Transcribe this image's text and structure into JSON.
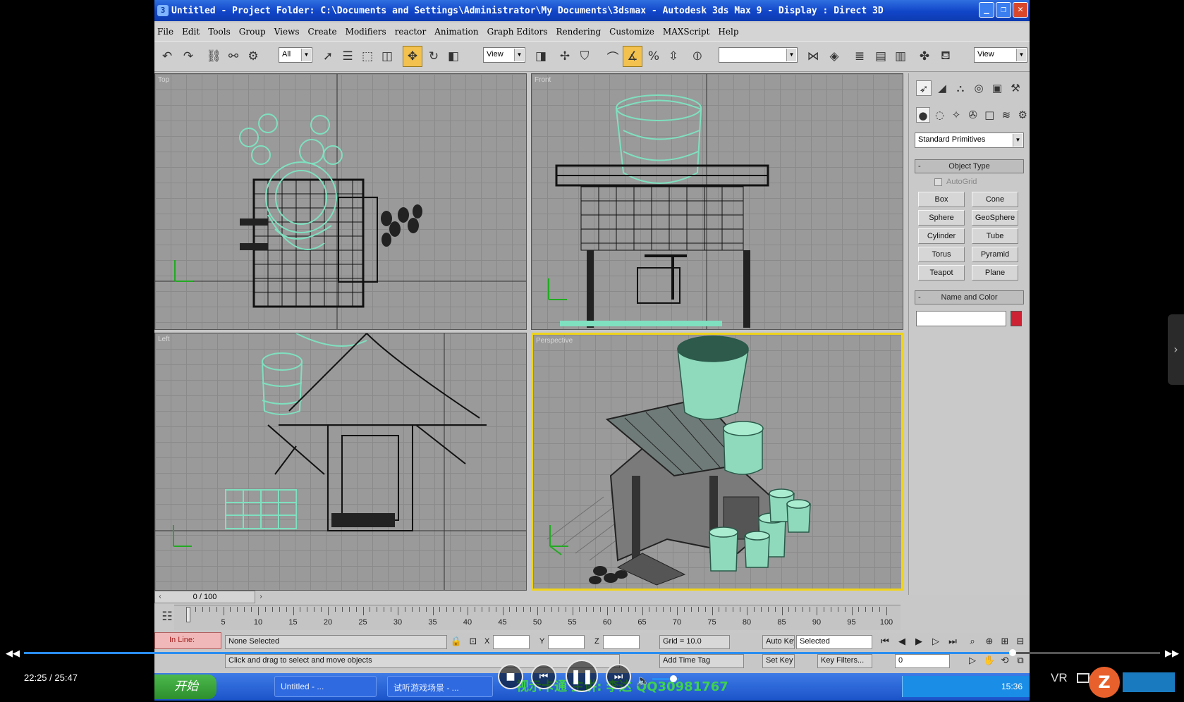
{
  "window": {
    "title": "Untitled     - Project Folder: C:\\Documents and Settings\\Administrator\\My Documents\\3dsmax     - Autodesk 3ds Max 9     - Display : Direct 3D",
    "minimize_icon": "minimize-icon",
    "restore_icon": "restore-icon",
    "close_icon": "close-icon"
  },
  "menu": [
    "File",
    "Edit",
    "Tools",
    "Group",
    "Views",
    "Create",
    "Modifiers",
    "reactor",
    "Animation",
    "Graph Editors",
    "Rendering",
    "Customize",
    "MAXScript",
    "Help"
  ],
  "toolbar": {
    "selection_filter": "All",
    "ref_coord": "View",
    "named_sets": "",
    "render_type": "View",
    "active_tool": "select-and-move"
  },
  "viewports": [
    {
      "name": "Top",
      "active": false
    },
    {
      "name": "Front",
      "active": false
    },
    {
      "name": "Left",
      "active": false
    },
    {
      "name": "Perspective",
      "active": true
    }
  ],
  "command_panel": {
    "category": "Standard Primitives",
    "object_type_header": "Object Type",
    "autogrid_label": "AutoGrid",
    "primitives": [
      "Box",
      "Cone",
      "Sphere",
      "GeoSphere",
      "Cylinder",
      "Tube",
      "Torus",
      "Pyramid",
      "Teapot",
      "Plane"
    ],
    "name_color_header": "Name and Color",
    "object_name": "",
    "object_color": "#cc2233"
  },
  "timeline": {
    "frame_display": "0 / 100",
    "tick_labels": [
      "5",
      "10",
      "15",
      "20",
      "25",
      "30",
      "35",
      "40",
      "45",
      "50",
      "55",
      "60",
      "65",
      "70",
      "75",
      "80",
      "85",
      "90",
      "95",
      "100"
    ]
  },
  "status": {
    "selection": "None Selected",
    "x_label": "X",
    "y_label": "Y",
    "z_label": "Z",
    "grid": "Grid = 10.0",
    "auto_key": "Auto Key",
    "key_mode": "Selected",
    "set_key": "Set Key",
    "key_filters": "Key Filters...",
    "prompt": "Click and drag to select and move objects",
    "add_time_tag": "Add Time Tag",
    "frame_field": "0",
    "maxscript_label": "In Line:"
  },
  "taskbar": {
    "start": "开始",
    "items": [
      "Untitled    - ...",
      "试听游戏场景 - ..."
    ],
    "watermark": "视示卡通 主讲: 李达 QQ30981767",
    "clock": "15:36"
  },
  "player": {
    "current_time": "22:25",
    "total_time": "25:47",
    "progress": 0.87,
    "volume": 0.75,
    "vr_label": "VR",
    "brand": "Z"
  },
  "colors": {
    "title_bar": "#1145c8",
    "active_viewport_border": "#f0d41a",
    "active_tool": "#f2c14e",
    "selected_wire": "#7fe0c0",
    "progress": "#2a8df0"
  }
}
